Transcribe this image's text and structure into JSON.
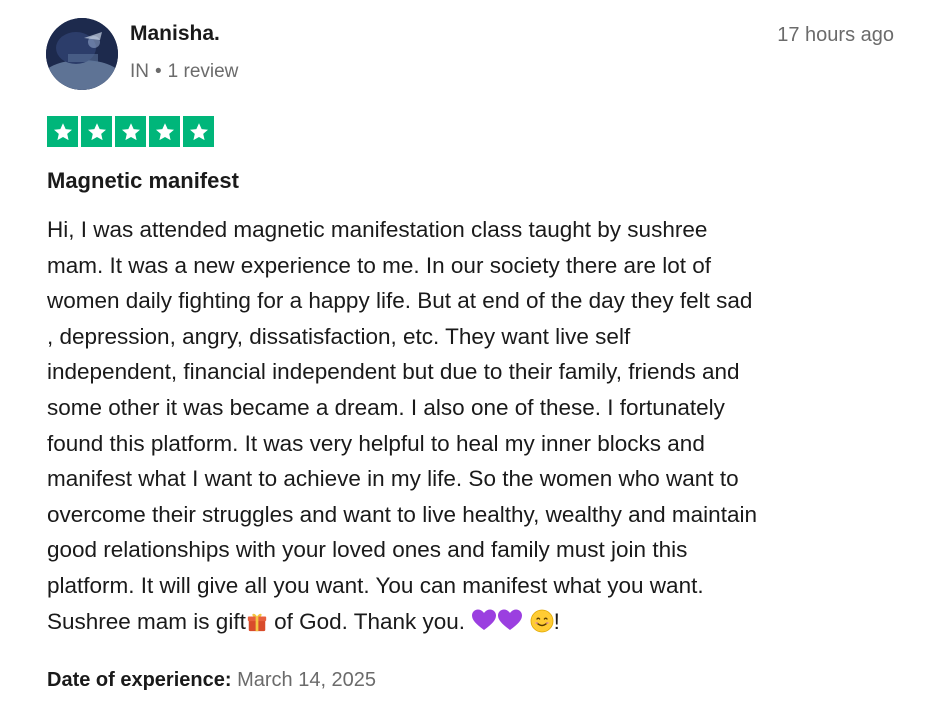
{
  "reviewer": {
    "name": "Manisha.",
    "country": "IN",
    "separator": "•",
    "review_count": "1 review"
  },
  "timestamp": "17 hours ago",
  "rating": {
    "stars": 5,
    "max": 5,
    "color": "#00b67a"
  },
  "review": {
    "title": "Magnetic manifest",
    "lines": [
      "Hi, I was attended magnetic manifestation class taught by sushree",
      "mam. It was a new experience to me. In our society there are lot of",
      "women daily fighting for a happy life. But at end of the day they felt sad",
      ", depression, angry, dissatisfaction, etc. They want live self",
      "independent, financial independent but due to their family, friends and",
      "some other it was became a dream. I also one of these. I fortunately",
      "found this platform. It was very helpful to heal my inner blocks and",
      "manifest what I want to achieve in my life. So the women who want to",
      "overcome their struggles and want to live healthy, wealthy and maintain",
      "good relationships with your loved ones and family must join this",
      "platform. It will give all you want. You can manifest what you want."
    ],
    "last_line": {
      "before_gift": "Sushree mam is gift",
      "after_gift": " of God. Thank you. ",
      "end": "!"
    }
  },
  "experience": {
    "label": "Date of experience:",
    "date": "March 14, 2025"
  },
  "icons": {
    "avatar": "avatar-photo",
    "star": "star-icon",
    "gift": "gift-emoji",
    "heart": "purple-heart-emoji",
    "smile": "smiling-face-emoji"
  }
}
